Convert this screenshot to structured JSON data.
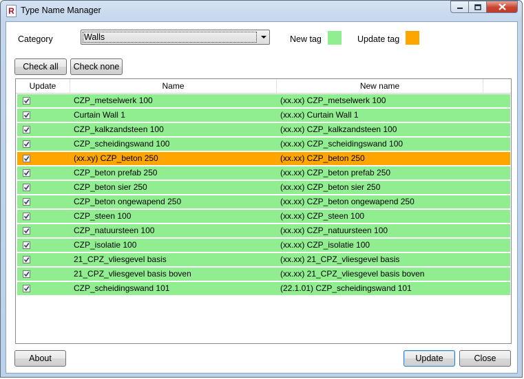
{
  "window": {
    "title": "Type Name Manager",
    "icon": "revit-r-icon"
  },
  "toolbar": {
    "category_label": "Category",
    "category_value": "Walls",
    "new_tag_label": "New tag",
    "new_tag_color": "#90ee90",
    "update_tag_label": "Update tag",
    "update_tag_color": "#ffa500",
    "check_all_label": "Check all",
    "check_none_label": "Check none"
  },
  "grid": {
    "columns": [
      "Update",
      "Name",
      "New name"
    ],
    "rows": [
      {
        "checked": true,
        "name": "CZP_metselwerk 100",
        "new_name": "(xx.xx) CZP_metselwerk 100",
        "tag": "new"
      },
      {
        "checked": true,
        "name": "Curtain Wall 1",
        "new_name": "(xx.xx) Curtain Wall 1",
        "tag": "new"
      },
      {
        "checked": true,
        "name": "CZP_kalkzandsteen 100",
        "new_name": "(xx.xx) CZP_kalkzandsteen 100",
        "tag": "new"
      },
      {
        "checked": true,
        "name": "CZP_scheidingswand 100",
        "new_name": "(xx.xx) CZP_scheidingswand 100",
        "tag": "new"
      },
      {
        "checked": true,
        "name": "(xx.xy) CZP_beton 250",
        "new_name": "(xx.xx) CZP_beton 250",
        "tag": "update"
      },
      {
        "checked": true,
        "name": "CZP_beton prefab 250",
        "new_name": "(xx.xx) CZP_beton prefab 250",
        "tag": "new"
      },
      {
        "checked": true,
        "name": "CZP_beton sier 250",
        "new_name": "(xx.xx) CZP_beton sier 250",
        "tag": "new"
      },
      {
        "checked": true,
        "name": "CZP_beton ongewapend 250",
        "new_name": "(xx.xx) CZP_beton ongewapend 250",
        "tag": "new"
      },
      {
        "checked": true,
        "name": "CZP_steen 100",
        "new_name": "(xx.xx) CZP_steen 100",
        "tag": "new"
      },
      {
        "checked": true,
        "name": "CZP_natuursteen 100",
        "new_name": "(xx.xx) CZP_natuursteen 100",
        "tag": "new"
      },
      {
        "checked": true,
        "name": "CZP_isolatie 100",
        "new_name": "(xx.xx) CZP_isolatie 100",
        "tag": "new"
      },
      {
        "checked": true,
        "name": "21_CPZ_vliesgevel basis",
        "new_name": "(xx.xx) 21_CPZ_vliesgevel basis",
        "tag": "new"
      },
      {
        "checked": true,
        "name": "21_CPZ_vliesgevel basis boven",
        "new_name": "(xx.xx) 21_CPZ_vliesgevel basis boven",
        "tag": "new"
      },
      {
        "checked": true,
        "name": "CZP_scheidingswand 101",
        "new_name": "(22.1.01) CZP_scheidingswand 101",
        "tag": "new"
      }
    ]
  },
  "footer": {
    "about_label": "About",
    "update_label": "Update",
    "close_label": "Close"
  }
}
